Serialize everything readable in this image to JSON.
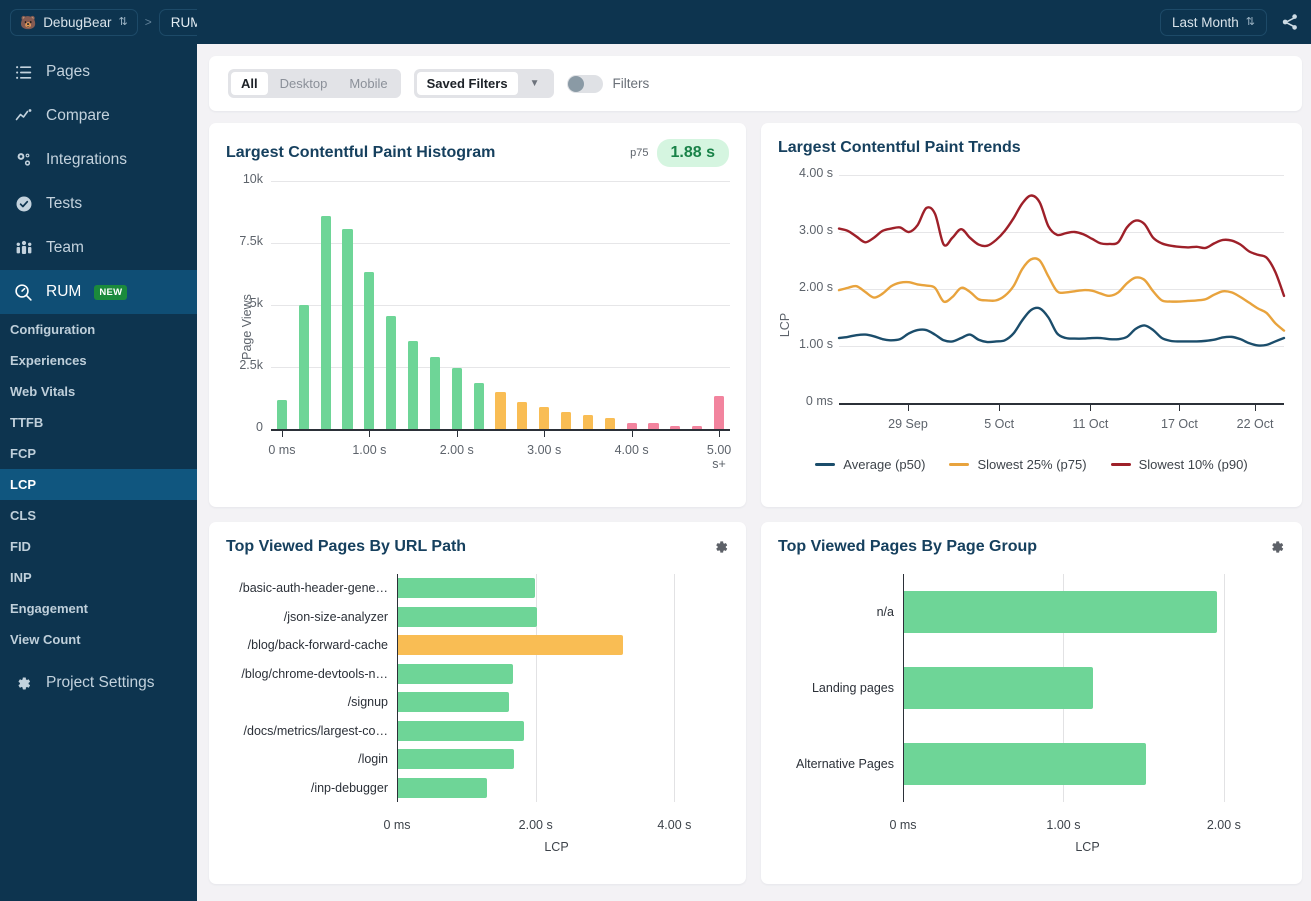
{
  "topbar": {
    "org_name": "DebugBear",
    "org_icon": "bear-icon",
    "breadcrumb_separator": ">",
    "breadcrumb_current": "RUM",
    "date_range": "Last Month",
    "share_icon": "share-icon"
  },
  "sidebar": {
    "items": [
      {
        "label": "Pages",
        "icon": "list-icon",
        "active": false
      },
      {
        "label": "Compare",
        "icon": "line-chart-icon",
        "active": false
      },
      {
        "label": "Integrations",
        "icon": "gears-icon",
        "active": false
      },
      {
        "label": "Tests",
        "icon": "check-circle-icon",
        "active": false
      },
      {
        "label": "Team",
        "icon": "people-icon",
        "active": false
      },
      {
        "label": "RUM",
        "icon": "magnifier-gauge-icon",
        "active": true,
        "badge": "NEW"
      }
    ],
    "subitems": [
      {
        "label": "Configuration",
        "active": false
      },
      {
        "label": "Experiences",
        "active": false
      },
      {
        "label": "Web Vitals",
        "active": false
      },
      {
        "label": "TTFB",
        "active": false
      },
      {
        "label": "FCP",
        "active": false
      },
      {
        "label": "LCP",
        "active": true
      },
      {
        "label": "CLS",
        "active": false
      },
      {
        "label": "FID",
        "active": false
      },
      {
        "label": "INP",
        "active": false
      },
      {
        "label": "Engagement",
        "active": false
      },
      {
        "label": "View Count",
        "active": false
      }
    ],
    "settings": {
      "label": "Project Settings",
      "icon": "gear-icon"
    }
  },
  "filterbar": {
    "device_options": [
      "All",
      "Desktop",
      "Mobile"
    ],
    "device_selected": "All",
    "saved_filters_label": "Saved Filters",
    "saved_filters_caret": "▼",
    "filters_toggle_label": "Filters",
    "filters_toggle_on": false
  },
  "cards": {
    "histogram": {
      "title": "Largest Contentful Paint Histogram",
      "p75_label": "p75",
      "p75_value": "1.88 s"
    },
    "trends": {
      "title": "Largest Contentful Paint Trends"
    },
    "url_path": {
      "title": "Top Viewed Pages By URL Path",
      "gear_icon": "gear-icon"
    },
    "page_group": {
      "title": "Top Viewed Pages By Page Group",
      "gear_icon": "gear-icon"
    }
  },
  "chart_data": [
    {
      "id": "lcp-histogram",
      "type": "bar",
      "title": "Largest Contentful Paint Histogram",
      "xlabel": "",
      "ylabel": "Page Views",
      "ylim": [
        0,
        10000
      ],
      "yticks": [
        "0",
        "2.5k",
        "5k",
        "7.5k",
        "10k"
      ],
      "ytick_values": [
        0,
        2500,
        5000,
        7500,
        10000
      ],
      "xticks": [
        "0 ms",
        "1.00 s",
        "2.00 s",
        "3.00 s",
        "4.00 s",
        "5.00 s+"
      ],
      "xtick_values": [
        0,
        1,
        2,
        3,
        4,
        5
      ],
      "grid": true,
      "bin_width": 0.25,
      "categories": [
        0,
        0.25,
        0.5,
        0.75,
        1.0,
        1.25,
        1.5,
        1.75,
        2.0,
        2.25,
        2.5,
        2.75,
        3.0,
        3.25,
        3.5,
        3.75,
        4.0,
        4.25,
        4.5,
        4.75,
        5.0
      ],
      "values": [
        1150,
        5000,
        8600,
        8050,
        6350,
        4550,
        3550,
        2900,
        2450,
        1850,
        1500,
        1100,
        900,
        700,
        550,
        450,
        260,
        230,
        140,
        110,
        1350
      ],
      "bar_colors": [
        "green",
        "green",
        "green",
        "green",
        "green",
        "green",
        "green",
        "green",
        "green",
        "green",
        "yellow",
        "yellow",
        "yellow",
        "yellow",
        "yellow",
        "yellow",
        "red",
        "red",
        "red",
        "red",
        "red"
      ],
      "colors": {
        "green": "#6ed597",
        "yellow": "#f9bd54",
        "red": "#f2849e"
      }
    },
    {
      "id": "lcp-trends",
      "type": "line",
      "title": "Largest Contentful Paint Trends",
      "xlabel": "",
      "ylabel": "LCP",
      "ylim": [
        0,
        4
      ],
      "yticks": [
        "0 ms",
        "1.00 s",
        "2.00 s",
        "3.00 s",
        "4.00 s"
      ],
      "ytick_values": [
        0,
        1,
        2,
        3,
        4
      ],
      "xticks": [
        "29 Sep",
        "5 Oct",
        "11 Oct",
        "17 Oct",
        "22 Oct"
      ],
      "xtick_positions": [
        0.155,
        0.36,
        0.565,
        0.765,
        0.935
      ],
      "grid": true,
      "legend_position": "bottom",
      "series": [
        {
          "name": "Average (p50)",
          "color": "#1b4d6b",
          "values": [
            1.14,
            1.16,
            1.19,
            1.2,
            1.17,
            1.12,
            1.1,
            1.12,
            1.22,
            1.28,
            1.28,
            1.2,
            1.1,
            1.08,
            1.14,
            1.2,
            1.11,
            1.07,
            1.08,
            1.1,
            1.22,
            1.45,
            1.63,
            1.66,
            1.5,
            1.22,
            1.14,
            1.13,
            1.13,
            1.14,
            1.14,
            1.12,
            1.12,
            1.16,
            1.3,
            1.36,
            1.28,
            1.14,
            1.09,
            1.08,
            1.08,
            1.08,
            1.09,
            1.11,
            1.15,
            1.16,
            1.12,
            1.05,
            1.01,
            1.02,
            1.08,
            1.14
          ]
        },
        {
          "name": "Slowest 25% (p75)",
          "color": "#e8a33d",
          "values": [
            1.98,
            2.02,
            2.05,
            1.95,
            1.85,
            1.92,
            2.05,
            2.11,
            2.12,
            2.08,
            2.06,
            2.02,
            1.78,
            1.86,
            2.02,
            1.95,
            1.82,
            1.8,
            1.8,
            1.88,
            2.05,
            2.35,
            2.52,
            2.5,
            2.22,
            1.96,
            1.94,
            1.96,
            1.98,
            1.97,
            1.92,
            1.88,
            1.94,
            2.1,
            2.2,
            2.16,
            1.96,
            1.8,
            1.78,
            1.78,
            1.79,
            1.8,
            1.82,
            1.9,
            1.96,
            1.94,
            1.86,
            1.76,
            1.66,
            1.58,
            1.4,
            1.27
          ]
        },
        {
          "name": "Slowest 10% (p90)",
          "color": "#9e2029",
          "values": [
            3.06,
            3.02,
            2.92,
            2.82,
            2.9,
            3.02,
            3.06,
            3.08,
            3.0,
            3.12,
            3.42,
            3.32,
            2.78,
            2.9,
            3.05,
            2.9,
            2.78,
            2.76,
            2.86,
            3.02,
            3.24,
            3.5,
            3.64,
            3.52,
            3.1,
            2.95,
            2.98,
            3.0,
            2.96,
            2.88,
            2.8,
            2.79,
            2.82,
            3.08,
            3.2,
            3.14,
            2.9,
            2.8,
            2.76,
            2.74,
            2.73,
            2.74,
            2.72,
            2.8,
            2.86,
            2.85,
            2.78,
            2.66,
            2.6,
            2.55,
            2.3,
            1.88
          ]
        }
      ]
    },
    {
      "id": "top-pages-url-path",
      "type": "bar",
      "orientation": "horizontal",
      "title": "Top Viewed Pages By URL Path",
      "xlabel": "LCP",
      "ylabel": "",
      "xlim": [
        0,
        4.6
      ],
      "xticks": [
        "0 ms",
        "2.00 s",
        "4.00 s"
      ],
      "xtick_values": [
        0,
        2,
        4
      ],
      "categories": [
        "/basic-auth-header-gene…",
        "/json-size-analyzer",
        "/blog/back-forward-cache",
        "/blog/chrome-devtools-n…",
        "/signup",
        "/docs/metrics/largest-co…",
        "/login",
        "/inp-debugger"
      ],
      "values": [
        1.97,
        2.0,
        3.25,
        1.66,
        1.6,
        1.82,
        1.67,
        1.29
      ],
      "bar_colors": [
        "green",
        "green",
        "yellow",
        "green",
        "green",
        "green",
        "green",
        "green"
      ],
      "colors": {
        "green": "#6ed597",
        "yellow": "#f9bd54"
      }
    },
    {
      "id": "top-pages-page-group",
      "type": "bar",
      "orientation": "horizontal",
      "title": "Top Viewed Pages By Page Group",
      "xlabel": "LCP",
      "ylabel": "",
      "xlim": [
        0,
        2.3
      ],
      "xticks": [
        "0 ms",
        "1.00 s",
        "2.00 s"
      ],
      "xtick_values": [
        0,
        1,
        2
      ],
      "categories": [
        "n/a",
        "Landing pages",
        "Alternative Pages"
      ],
      "values": [
        1.95,
        1.18,
        1.51
      ],
      "bar_colors": [
        "green",
        "green",
        "green"
      ],
      "colors": {
        "green": "#6ed597"
      }
    }
  ]
}
